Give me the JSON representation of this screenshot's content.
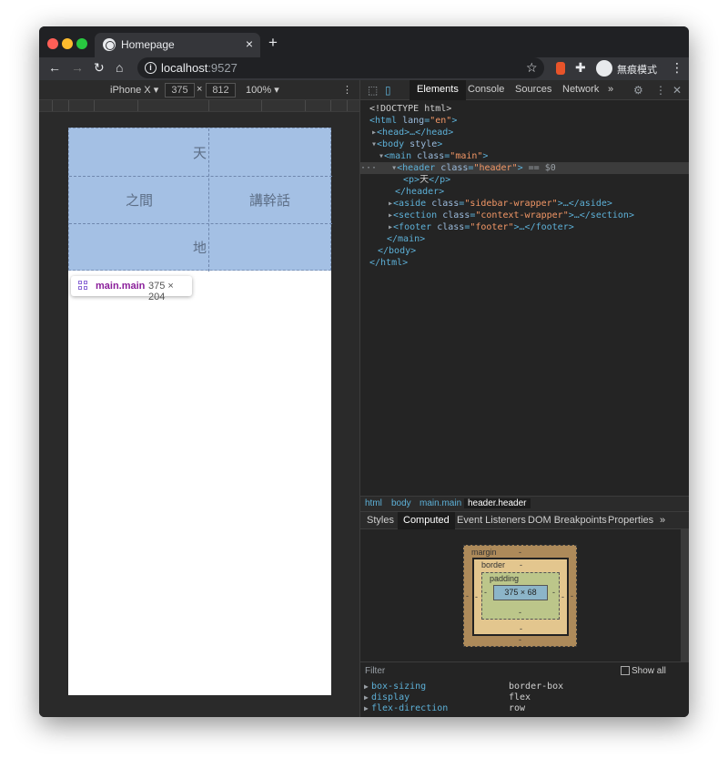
{
  "tab": {
    "title": "Homepage",
    "close": "×",
    "new": "+"
  },
  "address": {
    "host": "localhost",
    "port": ":9527",
    "incognito": "無痕模式"
  },
  "device": {
    "name": "iPhone X",
    "width": "375",
    "times": "×",
    "height": "812",
    "zoom": "100%"
  },
  "page": {
    "top_right": "天",
    "middle_left": "之間",
    "middle_right": "講幹話",
    "bottom_right": "地"
  },
  "tooltip": {
    "name": "main.main",
    "size": "375 × 204"
  },
  "devtools": {
    "tabs": [
      "Elements",
      "Console",
      "Sources",
      "Network",
      "»"
    ],
    "dom": {
      "l0": "<!DOCTYPE html>",
      "l1_open": "<html ",
      "l1_attr": "lang",
      "l1_val": "\"en\"",
      "l1_close": ">",
      "l2": "<head>…</head>",
      "l3_open": "<body ",
      "l3_attr": "style",
      "l3_close": ">",
      "l4_open": "<main ",
      "l4_attr": "class",
      "l4_val": "\"main\"",
      "l4_close": ">",
      "l5_open": "<header ",
      "l5_attr": "class",
      "l5_val": "\"header\"",
      "l5_close": ">",
      "l5_eq": " == $0",
      "l6_open": "<p>",
      "l6_text": "天",
      "l6_close": "</p>",
      "l7": "</header>",
      "l8_open": "<aside ",
      "l8_attr": "class",
      "l8_val": "\"sidebar-wrapper\"",
      "l8_close": ">…</aside>",
      "l9_open": "<section ",
      "l9_attr": "class",
      "l9_val": "\"context-wrapper\"",
      "l9_close": ">…</section>",
      "l10_open": "<footer ",
      "l10_attr": "class",
      "l10_val": "\"footer\"",
      "l10_close": ">…</footer>",
      "l11": "</main>",
      "l12": "</body>",
      "l13": "</html>"
    },
    "breadcrumbs": [
      "html",
      "body",
      "main.main",
      "header.header"
    ],
    "sub_tabs": [
      "Styles",
      "Computed",
      "Event Listeners",
      "DOM Breakpoints",
      "Properties",
      "»"
    ],
    "box_model": {
      "margin": "margin",
      "border": "border",
      "padding": "padding",
      "content": "375 × 68",
      "dash": "-"
    },
    "filter_label": "Filter",
    "show_all": "Show all",
    "computed": [
      {
        "name": "box-sizing",
        "value": "border-box"
      },
      {
        "name": "display",
        "value": "flex"
      },
      {
        "name": "flex-direction",
        "value": "row"
      }
    ]
  }
}
